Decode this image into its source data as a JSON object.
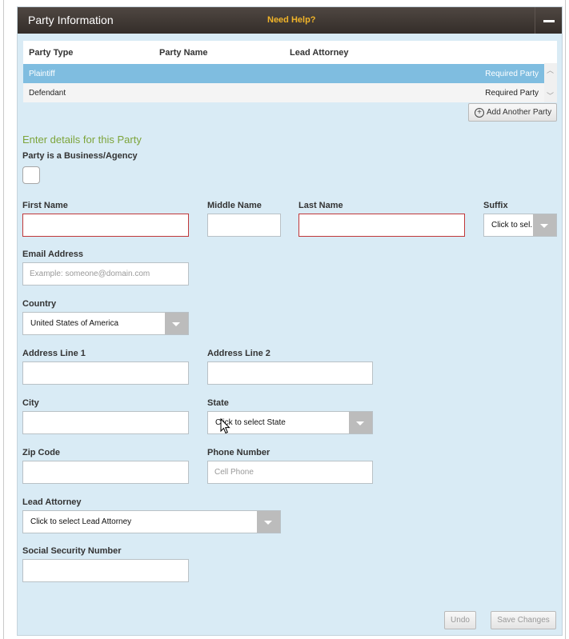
{
  "header": {
    "title": "Party Information",
    "help": "Need Help?"
  },
  "grid": {
    "columns": [
      "Party Type",
      "Party Name",
      "Lead Attorney"
    ],
    "rows": [
      {
        "type": "Plaintiff",
        "name": "",
        "attorney": "",
        "status": "Required Party"
      },
      {
        "type": "Defendant",
        "name": "",
        "attorney": "",
        "status": "Required Party"
      }
    ]
  },
  "add_party": "Add Another Party",
  "form": {
    "section_title": "Enter details for this Party",
    "business_label": "Party is a Business/Agency",
    "first_name_label": "First Name",
    "middle_name_label": "Middle Name",
    "last_name_label": "Last Name",
    "suffix_label": "Suffix",
    "suffix_value": "Click to sel...",
    "email_label": "Email Address",
    "email_placeholder": "Example: someone@domain.com",
    "country_label": "Country",
    "country_value": "United States of America",
    "address1_label": "Address Line 1",
    "address2_label": "Address Line 2",
    "city_label": "City",
    "state_label": "State",
    "state_value": "Click to select State",
    "zip_label": "Zip Code",
    "phone_label": "Phone Number",
    "phone_placeholder": "Cell Phone",
    "attorney_label": "Lead Attorney",
    "attorney_value": "Click to select Lead Attorney",
    "ssn_label": "Social Security Number"
  },
  "buttons": {
    "undo": "Undo",
    "save": "Save Changes"
  },
  "colors": {
    "header_bg": "#3a322e",
    "panel_bg": "#d9ebf5",
    "selected_row": "#7fbde0",
    "accent_green": "#7da43b",
    "help_orange": "#f0b429",
    "error_border": "#c0383a"
  },
  "icons": {
    "collapse": "minus-icon",
    "add": "plus-circle-icon",
    "dropdown": "chevron-down-icon",
    "cursor": "mouse-pointer-icon"
  }
}
